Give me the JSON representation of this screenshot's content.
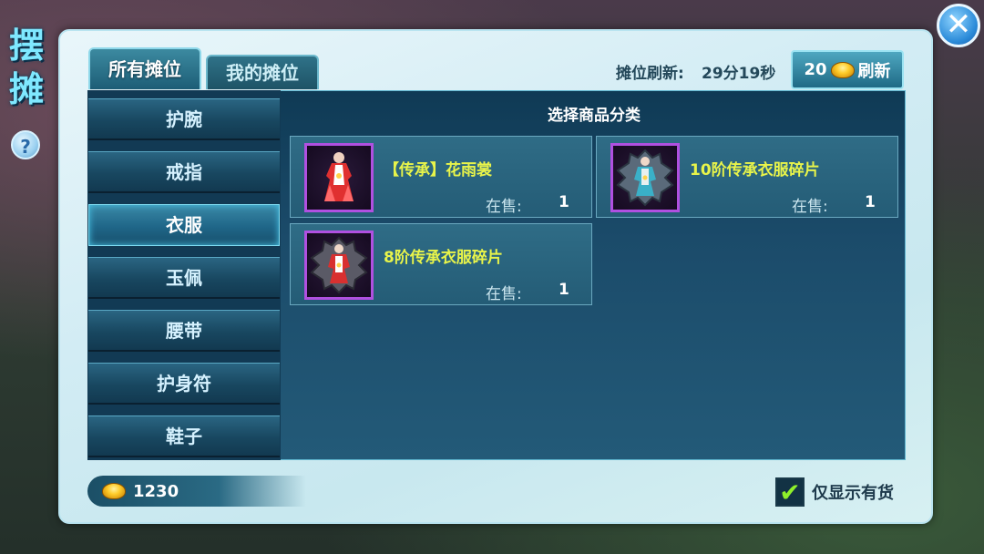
{
  "window": {
    "title": "摆摊",
    "help_label": "?",
    "close_label": "✕"
  },
  "tabs": [
    {
      "label": "所有摊位",
      "active": true
    },
    {
      "label": "我的摊位",
      "active": false
    }
  ],
  "refresh": {
    "label": "摊位刷新:",
    "countdown": "29分19秒",
    "cost": "20",
    "button_label": "刷新"
  },
  "categories": [
    {
      "label": "护腕",
      "active": false
    },
    {
      "label": "戒指",
      "active": false
    },
    {
      "label": "衣服",
      "active": true
    },
    {
      "label": "玉佩",
      "active": false
    },
    {
      "label": "腰带",
      "active": false
    },
    {
      "label": "护身符",
      "active": false
    },
    {
      "label": "鞋子",
      "active": false
    }
  ],
  "section_title": "选择商品分类",
  "items": [
    {
      "name": "【传承】花雨裳",
      "stock_label": "在售:",
      "stock": "1",
      "icon": "red-dress-icon"
    },
    {
      "name": "10阶传承衣服碎片",
      "stock_label": "在售:",
      "stock": "1",
      "icon": "blue-armor-fragment-icon"
    },
    {
      "name": "8阶传承衣服碎片",
      "stock_label": "在售:",
      "stock": "1",
      "icon": "red-dress-fragment-icon"
    }
  ],
  "currency": {
    "amount": "1230",
    "icon": "gold-ingot-icon"
  },
  "filter": {
    "label": "仅显示有货",
    "checked": true
  },
  "colors": {
    "item_name": "#e8f44a",
    "accent": "#3a88a6",
    "rarity_border": "#b050e0"
  }
}
